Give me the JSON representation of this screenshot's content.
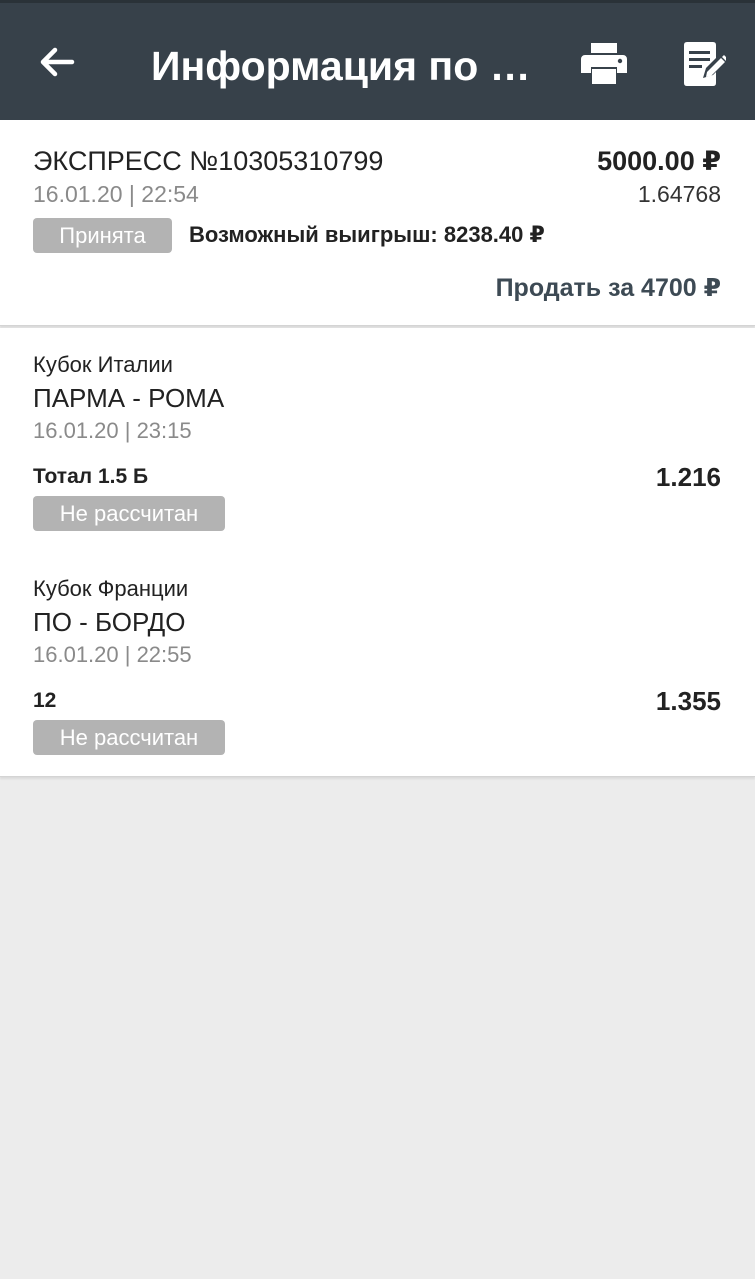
{
  "appbar": {
    "title": "Информация по с...",
    "background": "#37414a"
  },
  "bet": {
    "title": "ЭКСПРЕСС №10305310799",
    "amount": "5000.00 ₽",
    "datetime": "16.01.20 | 22:54",
    "coefficient": "1.64768",
    "status": "Принята",
    "possible_win": "Возможный выигрыш: 8238.40 ₽",
    "sell_label": "Продать за 4700 ₽"
  },
  "events": [
    {
      "tournament": "Кубок Италии",
      "teams": "ПАРМА - РОМА",
      "datetime": "16.01.20 | 23:15",
      "outcome": "Тотал 1.5 Б",
      "coefficient": "1.216",
      "status": "Не рассчитан"
    },
    {
      "tournament": "Кубок Франции",
      "teams": "ПО - БОРДО",
      "datetime": "16.01.20 | 22:55",
      "outcome": "12",
      "coefficient": "1.355",
      "status": "Не рассчитан"
    }
  ],
  "icons": {
    "back": "arrow-left-icon",
    "print": "printer-icon",
    "edit": "edit-note-icon"
  }
}
